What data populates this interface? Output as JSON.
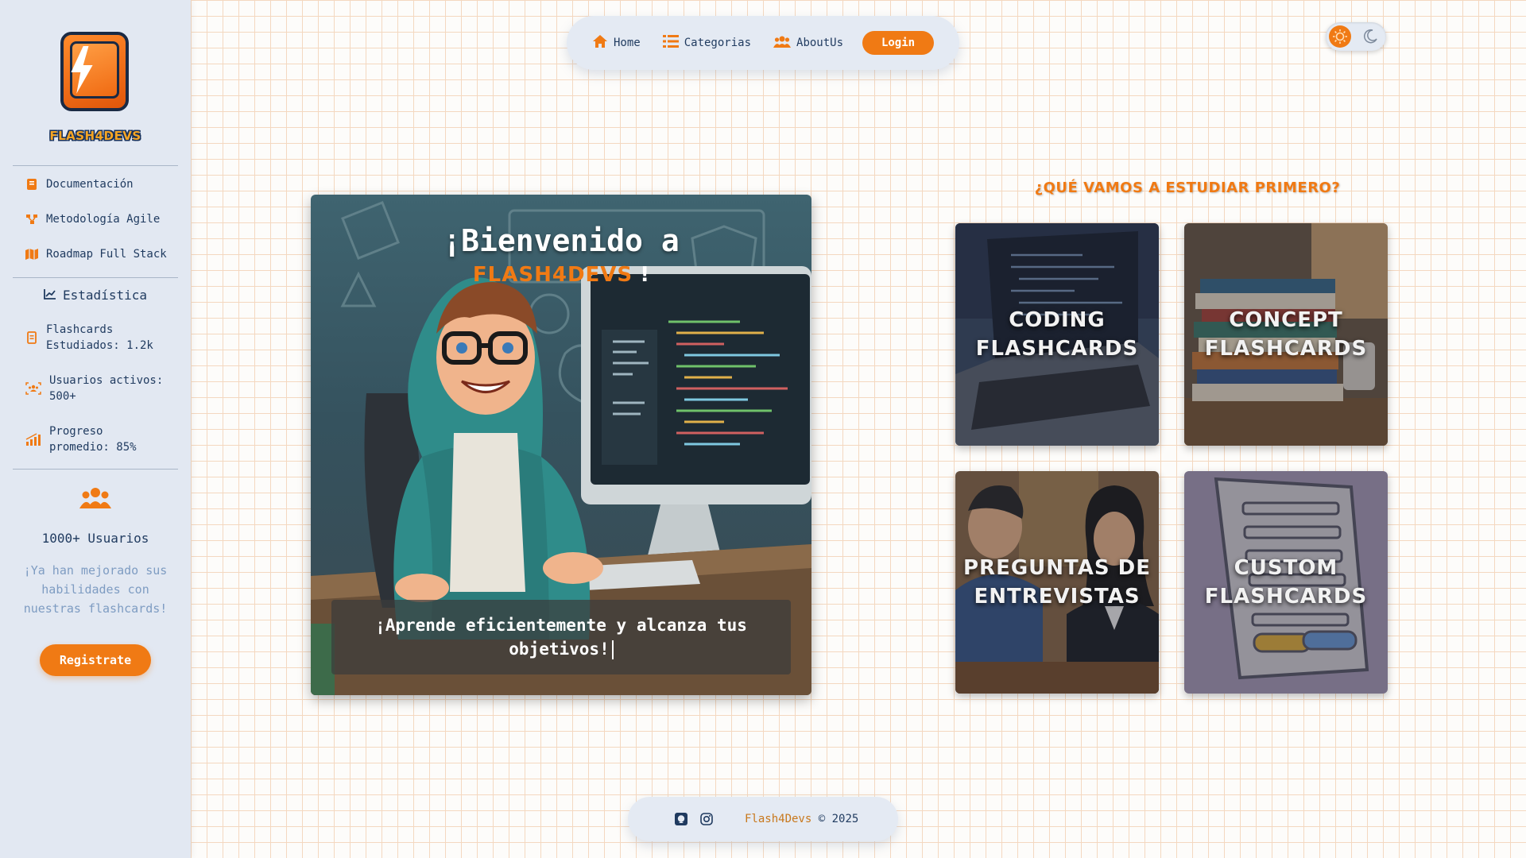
{
  "sidebar": {
    "logo_text": "FLASH4DEVS",
    "links": [
      {
        "label": "Documentación",
        "icon": "book-icon"
      },
      {
        "label": "Metodología Agile",
        "icon": "agile-icon"
      },
      {
        "label": "Roadmap Full Stack",
        "icon": "map-icon"
      }
    ],
    "stats_title": "Estadística",
    "stats": [
      {
        "line1": "Flashcards",
        "line2": "Estudiados: 1.2k",
        "icon": "card-icon"
      },
      {
        "line1": "Usuarios activos:",
        "line2": "500+",
        "icon": "users-scan-icon"
      },
      {
        "line1": "Progreso",
        "line2": "promedio: 85%",
        "icon": "signal-icon"
      }
    ],
    "users_count": "1000+ Usuarios",
    "users_message": "¡Ya han mejorado sus habilidades con nuestras flashcards!",
    "register_label": "Registrate"
  },
  "navbar": {
    "home": "Home",
    "categories": "Categorias",
    "about": "AboutUs",
    "login": "Login"
  },
  "hero": {
    "title": "¡Bienvenido a",
    "brand": "FLASH4DEVS",
    "brand_suffix": " !",
    "caption": "¡Aprende eficientemente y alcanza tus objetivos!"
  },
  "study": {
    "heading": "¿QUÉ VAMOS A ESTUDIAR PRIMERO?",
    "cards": [
      {
        "label": "CODING FLASHCARDS"
      },
      {
        "label": "CONCEPT FLASHCARDS"
      },
      {
        "label": "PREGUNTAS DE ENTREVISTAS"
      },
      {
        "label": "CUSTOM FLASHCARDS"
      }
    ]
  },
  "footer": {
    "brand": "Flash4Devs",
    "copyright": " © 2025"
  },
  "colors": {
    "accent": "#f07a14",
    "text": "#1f3a5f",
    "sidebar_bg": "#e2e8f2",
    "grid": "#f4d8c0"
  }
}
